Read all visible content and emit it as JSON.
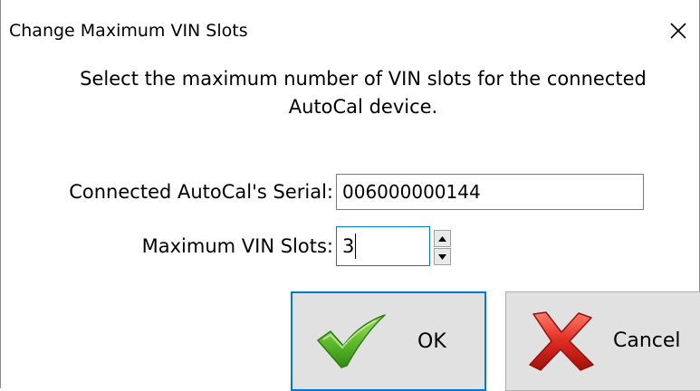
{
  "window": {
    "title": "Change Maximum VIN Slots",
    "close_glyph": "✕"
  },
  "description": {
    "line1": "Select the maximum number of VIN slots for the connected",
    "line2": "AutoCal device."
  },
  "serial": {
    "label": "Connected AutoCal's Serial:",
    "value": "006000000144"
  },
  "slots": {
    "label": "Maximum VIN Slots:",
    "value": "3"
  },
  "buttons": {
    "ok": {
      "label": "OK",
      "icon": "checkmark-icon"
    },
    "cancel": {
      "label": "Cancel",
      "icon": "red-x-icon"
    }
  },
  "colors": {
    "focus_border": "#0078d7",
    "button_face": "#e1e1e1",
    "check_green": "#5cb82a",
    "cancel_red": "#d9251d"
  }
}
